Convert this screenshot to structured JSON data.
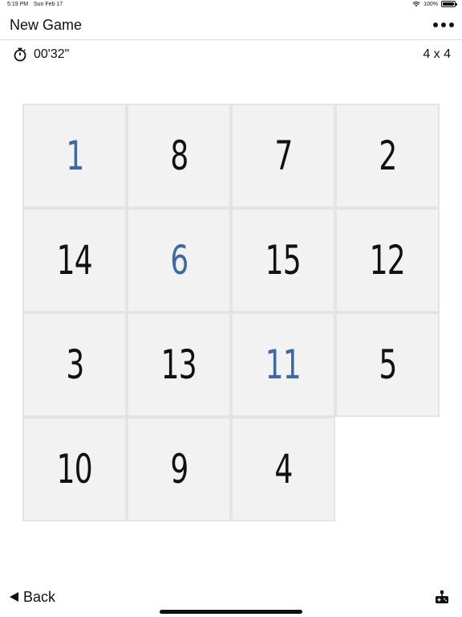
{
  "status_bar": {
    "time": "5:19 PM",
    "date": "Sun Feb 17",
    "battery": "100%"
  },
  "nav": {
    "title": "New Game",
    "more_icon": "ellipsis-icon"
  },
  "info": {
    "timer": "00'32\"",
    "grid_size": "4 x 4",
    "timer_icon": "stopwatch-icon"
  },
  "board": {
    "rows": 4,
    "cols": 4,
    "tiles": [
      {
        "value": "1",
        "correct": true
      },
      {
        "value": "8",
        "correct": false
      },
      {
        "value": "7",
        "correct": false
      },
      {
        "value": "2",
        "correct": false
      },
      {
        "value": "14",
        "correct": false
      },
      {
        "value": "6",
        "correct": true
      },
      {
        "value": "15",
        "correct": false
      },
      {
        "value": "12",
        "correct": false
      },
      {
        "value": "3",
        "correct": false
      },
      {
        "value": "13",
        "correct": false
      },
      {
        "value": "11",
        "correct": true
      },
      {
        "value": "5",
        "correct": false
      },
      {
        "value": "10",
        "correct": false
      },
      {
        "value": "9",
        "correct": false
      },
      {
        "value": "4",
        "correct": false
      },
      null
    ],
    "colors": {
      "correct": "#3b6aa8",
      "normal": "#111111",
      "tile_bg": "#f2f2f2"
    }
  },
  "bottom": {
    "back_label": "Back",
    "back_icon": "back-arrow-icon",
    "game_icon": "game-controller-icon"
  }
}
